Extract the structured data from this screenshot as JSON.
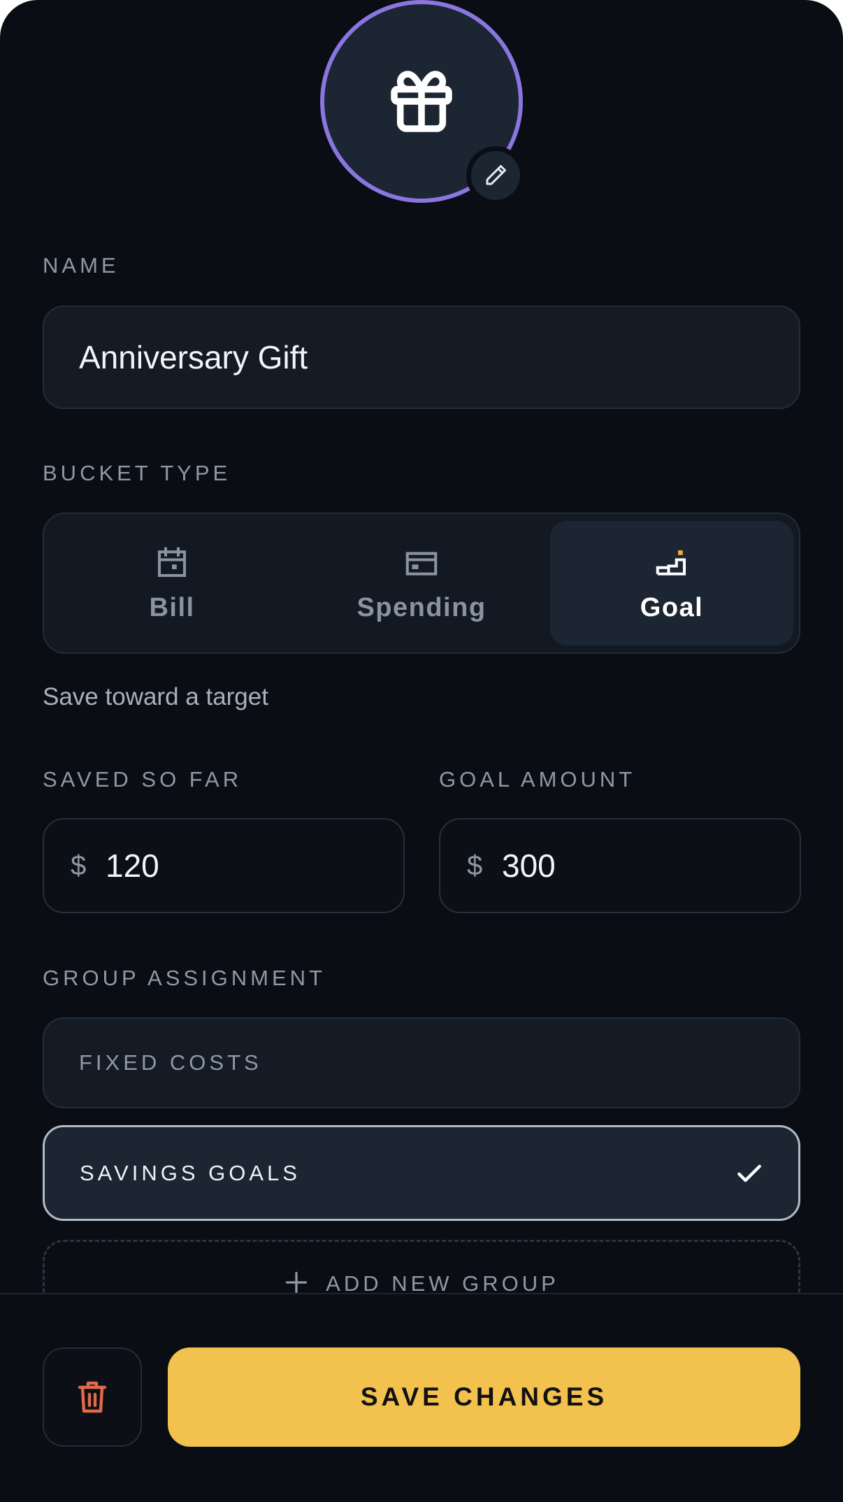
{
  "form": {
    "name_label": "NAME",
    "name_value": "Anniversary Gift",
    "bucket_type_label": "BUCKET TYPE",
    "bucket_types": [
      {
        "label": "Bill",
        "icon": "calendar-icon"
      },
      {
        "label": "Spending",
        "icon": "card-icon"
      },
      {
        "label": "Goal",
        "icon": "stairs-flag-icon",
        "selected": true
      }
    ],
    "helper_text": "Save toward a target",
    "saved_label": "SAVED SO FAR",
    "saved_currency": "$",
    "saved_value": "120",
    "goal_label": "GOAL AMOUNT",
    "goal_currency": "$",
    "goal_value": "300",
    "group_label": "GROUP ASSIGNMENT",
    "groups": [
      {
        "label": "FIXED COSTS",
        "selected": false
      },
      {
        "label": "SAVINGS GOALS",
        "selected": true
      }
    ],
    "add_group_label": "ADD NEW GROUP"
  },
  "avatar": {
    "icon": "gift-icon",
    "ring_color": "#8b75e0",
    "edit_icon": "pencil-icon"
  },
  "footer": {
    "save_label": "SAVE CHANGES",
    "delete_icon": "trash-icon"
  },
  "colors": {
    "accent": "#f2c14e",
    "danger": "#e06a4a",
    "goal_flag": "#f2a93b",
    "background": "#0a0e14"
  }
}
